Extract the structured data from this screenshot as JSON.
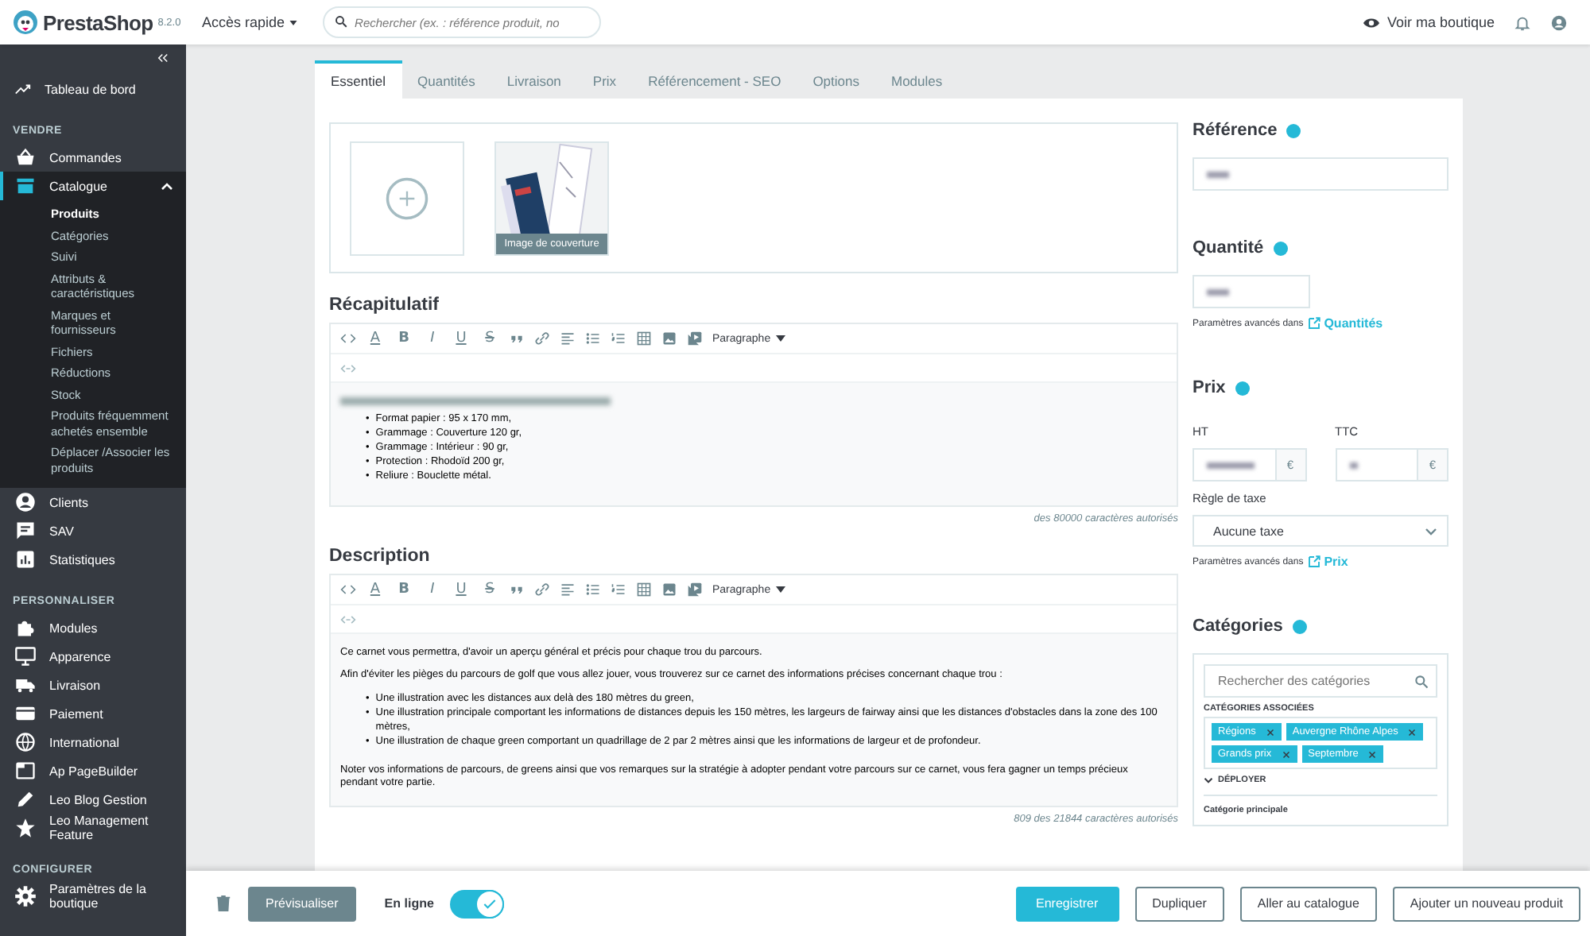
{
  "header": {
    "logo": "PrestaShop",
    "version": "8.2.0",
    "quick_access": "Accès rapide",
    "search_placeholder": "Rechercher (ex. : référence produit, no",
    "view_shop": "Voir ma boutique"
  },
  "sidebar": {
    "top": {
      "label": "Tableau de bord",
      "selected": false
    },
    "sections": [
      {
        "title": "VENDRE",
        "items": [
          {
            "label": "Commandes",
            "selected": false,
            "expanded": false
          },
          {
            "label": "Catalogue",
            "selected": true,
            "expanded": true,
            "children": [
              {
                "label": "Produits",
                "selected": true
              },
              {
                "label": "Catégories",
                "selected": false
              },
              {
                "label": "Suivi",
                "selected": false
              },
              {
                "label": "Attributs & caractéristiques",
                "selected": false
              },
              {
                "label": "Marques et fournisseurs",
                "selected": false
              },
              {
                "label": "Fichiers",
                "selected": false
              },
              {
                "label": "Réductions",
                "selected": false
              },
              {
                "label": "Stock",
                "selected": false
              },
              {
                "label": "Produits fréquemment achetés ensemble",
                "selected": false
              },
              {
                "label": "Déplacer /Associer les produits",
                "selected": false
              }
            ]
          },
          {
            "label": "Clients",
            "selected": false,
            "expanded": false
          },
          {
            "label": "SAV",
            "selected": false,
            "expanded": false
          },
          {
            "label": "Statistiques",
            "selected": false,
            "expanded": false
          }
        ]
      },
      {
        "title": "PERSONNALISER",
        "items": [
          {
            "label": "Modules",
            "selected": false,
            "expanded": false
          },
          {
            "label": "Apparence",
            "selected": false,
            "expanded": false
          },
          {
            "label": "Livraison",
            "selected": false,
            "expanded": false
          },
          {
            "label": "Paiement",
            "selected": false,
            "expanded": false
          },
          {
            "label": "International",
            "selected": false,
            "expanded": false
          },
          {
            "label": "Ap PageBuilder",
            "selected": false,
            "expanded": false
          },
          {
            "label": "Leo Blog Gestion",
            "selected": false,
            "expanded": false
          },
          {
            "label": "Leo Management Feature",
            "selected": false,
            "expanded": false
          }
        ]
      },
      {
        "title": "CONFIGURER",
        "items": [
          {
            "label": "Paramètres de la boutique",
            "selected": false,
            "expanded": false
          }
        ]
      }
    ]
  },
  "tabs": [
    {
      "label": "Essentiel",
      "selected": true
    },
    {
      "label": "Quantités",
      "selected": false
    },
    {
      "label": "Livraison",
      "selected": false
    },
    {
      "label": "Prix",
      "selected": false
    },
    {
      "label": "Référencement - SEO",
      "selected": false
    },
    {
      "label": "Options",
      "selected": false
    },
    {
      "label": "Modules",
      "selected": false
    }
  ],
  "images": {
    "cover_caption": "Image de couverture"
  },
  "editors": [
    {
      "title": "Récapitulatif",
      "format_label": "Paragraphe",
      "glyphs": [
        "A",
        "B",
        "I",
        "U",
        "S"
      ],
      "blocks": [
        {
          "kind": "blurred"
        },
        {
          "kind": "list",
          "marker": "•",
          "items": [
            "Format papier : 95 x 170 mm,",
            "Grammage : Couverture 120 gr,",
            "Grammage : Intérieur : 90 gr,",
            "Protection : Rhodoïd 200 gr,",
            "Reliure : Bouclette métal."
          ]
        }
      ],
      "counter": "des 80000 caractères autorisés"
    },
    {
      "title": "Description",
      "format_label": "Paragraphe",
      "glyphs": [
        "A",
        "B",
        "I",
        "U",
        "S"
      ],
      "blocks": [
        {
          "kind": "paragraph",
          "text": "Ce carnet vous permettra, d'avoir un aperçu général et précis pour chaque trou du parcours."
        },
        {
          "kind": "paragraph",
          "text": "Afin d'éviter les pièges du parcours de golf que vous allez jouer, vous trouverez sur ce carnet des informations précises concernant chaque trou :"
        },
        {
          "kind": "list",
          "marker": "•",
          "items": [
            "Une illustration avec les distances aux delà des 180 mètres du green,",
            "Une illustration principale comportant les informations de distances depuis les 150 mètres, les largeurs de fairway ainsi que les distances d'obstacles dans la zone des 100 mètres,",
            "Une illustration de chaque green comportant un quadrillage de 2 par 2 mètres ainsi que les informations de largeur et de profondeur."
          ]
        },
        {
          "kind": "paragraph",
          "text": "Noter vos informations de parcours, de greens ainsi que vos remarques sur la stratégie à adopter pendant votre parcours sur ce carnet, vous fera gagner un temps précieux pendant votre partie."
        }
      ],
      "counter": "809 des 21844 caractères autorisés"
    }
  ],
  "reference": {
    "title": "Référence"
  },
  "quantity": {
    "title": "Quantité",
    "advanced": "Paramètres avancés dans",
    "link": "Quantités"
  },
  "price": {
    "title": "Prix",
    "ht_label": "HT",
    "ttc_label": "TTC",
    "currency_ht": "€",
    "currency_ttc": "€",
    "tax_label": "Règle de taxe",
    "tax_value": "Aucune taxe",
    "advanced": "Paramètres avancés dans",
    "link": "Prix"
  },
  "categories": {
    "title": "Catégories",
    "search_placeholder": "Rechercher des catégories",
    "associated_label": "CATÉGORIES ASSOCIÉES",
    "tags": [
      "Régions",
      "Auvergne Rhône Alpes",
      "Grands prix",
      "Septembre"
    ],
    "expand_label": "DÉPLOYER",
    "main_label": "Catégorie principale"
  },
  "footer": {
    "preview": "Prévisualiser",
    "online_label": "En ligne",
    "online": true,
    "save": "Enregistrer",
    "duplicate": "Dupliquer",
    "catalog": "Aller au catalogue",
    "new_product": "Ajouter un nouveau produit"
  }
}
